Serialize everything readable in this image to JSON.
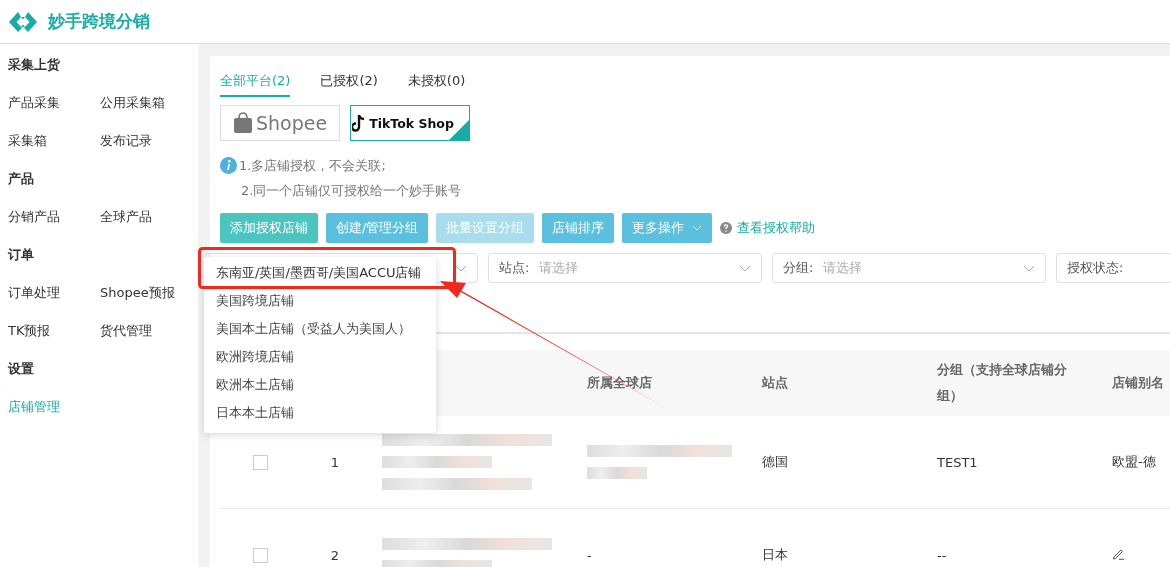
{
  "app": {
    "title": "妙手跨境分销"
  },
  "sidebar": [
    {
      "heading": "采集上货",
      "items": [
        {
          "label": "产品采集",
          "selected": false
        },
        {
          "label": "公用采集箱",
          "selected": false
        },
        {
          "label": "采集箱",
          "selected": false
        },
        {
          "label": "发布记录",
          "selected": false
        }
      ]
    },
    {
      "heading": "产品",
      "items": [
        {
          "label": "分销产品",
          "selected": false
        },
        {
          "label": "全球产品",
          "selected": false
        }
      ]
    },
    {
      "heading": "订单",
      "items": [
        {
          "label": "订单处理",
          "selected": false
        },
        {
          "label": "Shopee预报",
          "selected": false
        },
        {
          "label": "TK预报",
          "selected": false
        },
        {
          "label": "货代管理",
          "selected": false
        }
      ]
    },
    {
      "heading": "设置",
      "items": [
        {
          "label": "店铺管理",
          "selected": true
        }
      ]
    }
  ],
  "tabs": [
    {
      "label": "全部平台(2)",
      "selected": true
    },
    {
      "label": "已授权(2)",
      "selected": false
    },
    {
      "label": "未授权(0)",
      "selected": false
    }
  ],
  "platforms": [
    {
      "kind": "shopee",
      "label": "Shopee",
      "selected": false
    },
    {
      "kind": "tiktok",
      "label": "TikTok Shop",
      "selected": true
    }
  ],
  "notes": [
    "1.多店铺授权，不会关联;",
    "2.同一个店铺仅可授权给一个妙手账号"
  ],
  "actions": [
    {
      "label": "添加授权店铺",
      "kind": "primary",
      "disabled": false
    },
    {
      "label": "创建/管理分组",
      "kind": "info",
      "disabled": false
    },
    {
      "label": "批量设置分组",
      "kind": "info",
      "disabled": true
    },
    {
      "label": "店铺排序",
      "kind": "info",
      "disabled": false
    },
    {
      "label": "更多操作",
      "kind": "dropdown",
      "disabled": false
    }
  ],
  "help_link": "查看授权帮助",
  "menu": {
    "items": [
      {
        "label": "东南亚/英国/墨西哥/美国ACCU店铺",
        "highlighted": true
      },
      {
        "label": "美国跨境店铺",
        "highlighted": false
      },
      {
        "label": "美国本土店铺（受益人为美国人）",
        "highlighted": false
      },
      {
        "label": "欧洲跨境店铺",
        "highlighted": false
      },
      {
        "label": "欧洲本土店铺",
        "highlighted": false
      },
      {
        "label": "日本本土店铺",
        "highlighted": false
      }
    ]
  },
  "filters": [
    {
      "chevron": true
    },
    {
      "label": "站点:",
      "placeholder": "请选择",
      "chevron": true
    },
    {
      "label": "分组:",
      "placeholder": "请选择",
      "chevron": true
    },
    {
      "label": "授权状态:"
    }
  ],
  "table": {
    "columns": [
      "所属全球店",
      "站点",
      "分组（支持全球店铺分组）",
      "店铺别名"
    ],
    "rows": [
      {
        "index": "1",
        "checked": false,
        "site": "德国",
        "group": "TEST1",
        "alias": {
          "kind": "text",
          "text": "欧盟-德"
        }
      },
      {
        "index": "2",
        "checked": false,
        "global_store": "-",
        "site": "日本",
        "group": "--",
        "alias": {
          "kind": "edit"
        }
      }
    ]
  }
}
